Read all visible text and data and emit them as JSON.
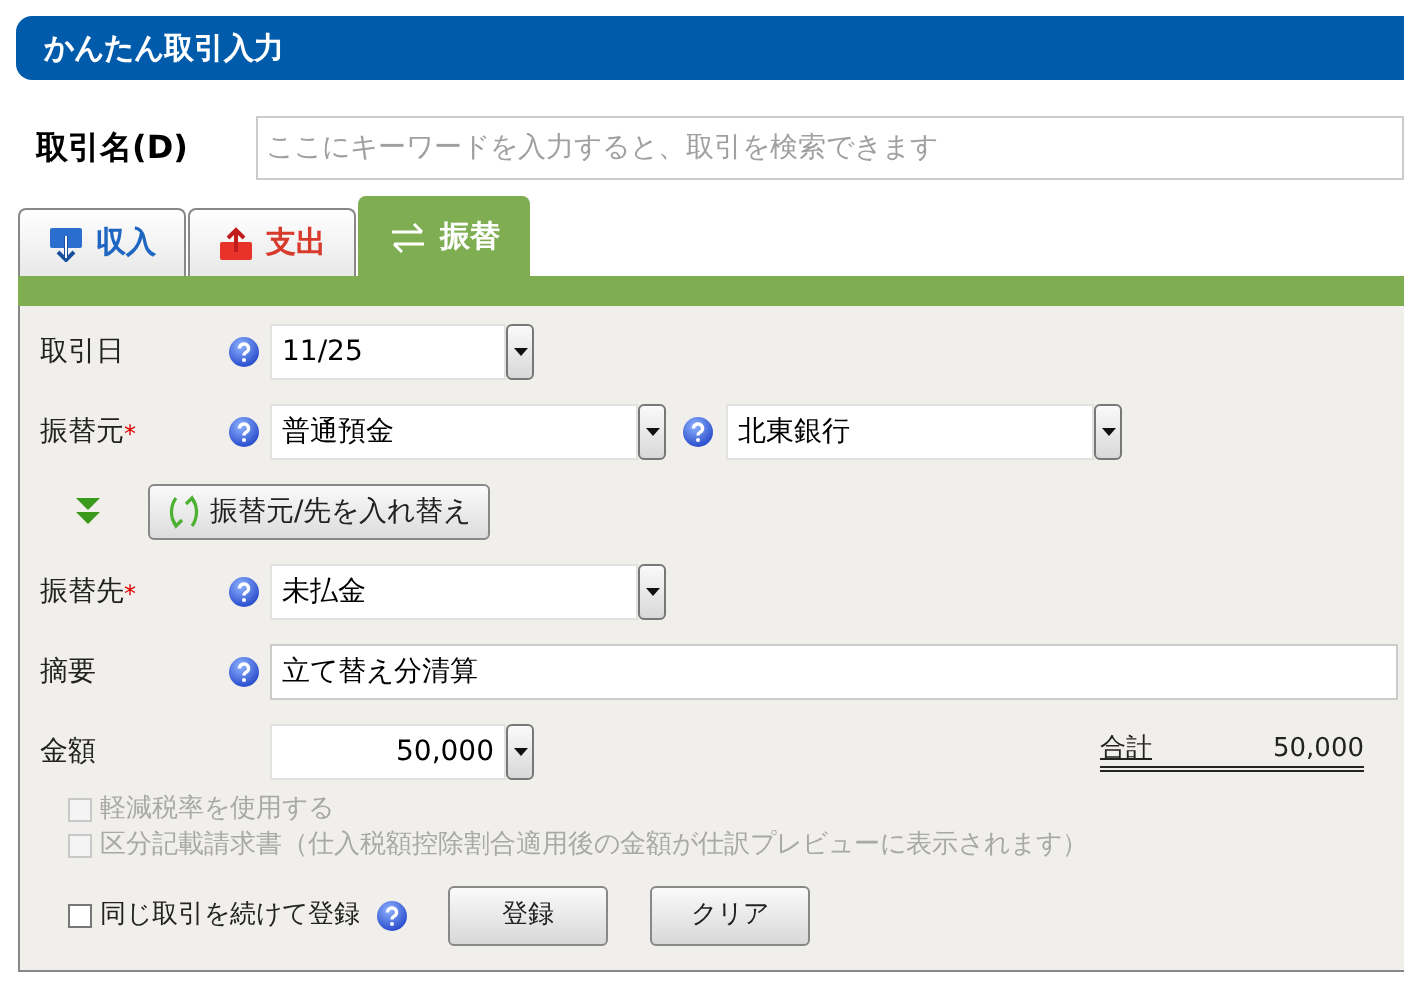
{
  "title": "かんたん取引入力",
  "search": {
    "label": "取引名(D)",
    "placeholder": "ここにキーワードを入力すると、取引を検索できます"
  },
  "tabs": [
    {
      "label": "収入",
      "kind": "income",
      "selected": false
    },
    {
      "label": "支出",
      "kind": "expense",
      "selected": false
    },
    {
      "label": "振替",
      "kind": "transfer",
      "selected": true
    }
  ],
  "date": {
    "label": "取引日",
    "value": "11/25"
  },
  "from": {
    "label": "振替元",
    "mark": "*",
    "value": "普通預金",
    "bank": "北東銀行"
  },
  "swap_button": "振替元/先を入れ替え",
  "to": {
    "label": "振替先",
    "mark": "*",
    "value": "未払金"
  },
  "memo": {
    "label": "摘要",
    "value": "立て替え分清算"
  },
  "amount": {
    "label": "金額",
    "value": "50,000"
  },
  "total": {
    "label": "合計",
    "value": "50,000"
  },
  "options": [
    {
      "label": "軽減税率を使用する",
      "checked": false,
      "disabled": true
    },
    {
      "label": "区分記載請求書（仕入税額控除割合適用後の金額が仕訳プレビューに表示されます）",
      "checked": false,
      "disabled": true
    }
  ],
  "repeat": {
    "label": "同じ取引を続けて登録",
    "checked": false
  },
  "buttons": [
    "登録",
    "クリア"
  ]
}
